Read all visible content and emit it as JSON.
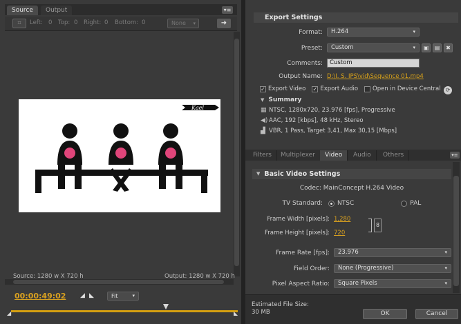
{
  "left_panel": {
    "tabs": [
      "Source",
      "Output"
    ],
    "menu_icon": "panel-menu-icon",
    "crop": {
      "left_label": "Left:",
      "left_value": "0",
      "top_label": "Top:",
      "top_value": "0",
      "right_label": "Right:",
      "right_value": "0",
      "bottom_label": "Bottom:",
      "bottom_value": "0",
      "ratio_select": "None"
    },
    "video_overlay_text": "Kael",
    "source_dims": "Source: 1280 w X 720 h",
    "output_dims": "Output: 1280 w X 720 h",
    "timecode": "00:00:49:02",
    "zoom_select": "Fit"
  },
  "export_settings": {
    "title": "Export Settings",
    "format_label": "Format:",
    "format_value": "H.264",
    "preset_label": "Preset:",
    "preset_value": "Custom",
    "comments_label": "Comments:",
    "comments_value": "Custom",
    "output_name_label": "Output Name:",
    "output_name_value": "D:\\I. S. IPS\\vid\\Sequence 01.mp4",
    "export_video": "Export Video",
    "export_audio": "Export Audio",
    "open_device": "Open in Device Central",
    "summary_title": "Summary",
    "summary_lines": [
      "NTSC, 1280x720, 23.976 [fps], Progressive",
      "AAC, 192 [kbps], 48 kHz, Stereo",
      "VBR, 1 Pass, Target 3,41, Max 30,15 [Mbps]"
    ]
  },
  "settings_tabs": [
    "Filters",
    "Multiplexer",
    "Video",
    "Audio",
    "Others"
  ],
  "video_settings": {
    "title": "Basic Video Settings",
    "codec_label": "Codec:",
    "codec_value": "MainConcept H.264 Video",
    "tv_label": "TV Standard:",
    "tv_ntsc": "NTSC",
    "tv_pal": "PAL",
    "width_label": "Frame Width [pixels]:",
    "width_value": "1,280",
    "height_label": "Frame Height [pixels]:",
    "height_value": "720",
    "fps_label": "Frame Rate [fps]:",
    "fps_value": "23.976",
    "field_label": "Field Order:",
    "field_value": "None (Progressive)",
    "par_label": "Pixel Aspect Ratio:",
    "par_value": "Square Pixels"
  },
  "footer": {
    "est_label": "Estimated File Size:",
    "est_value": "30 MB",
    "ok": "OK",
    "cancel": "Cancel"
  },
  "colors": {
    "accent": "#d8a020",
    "panel_bg": "#3a3a3a",
    "header_bg": "#454545"
  }
}
